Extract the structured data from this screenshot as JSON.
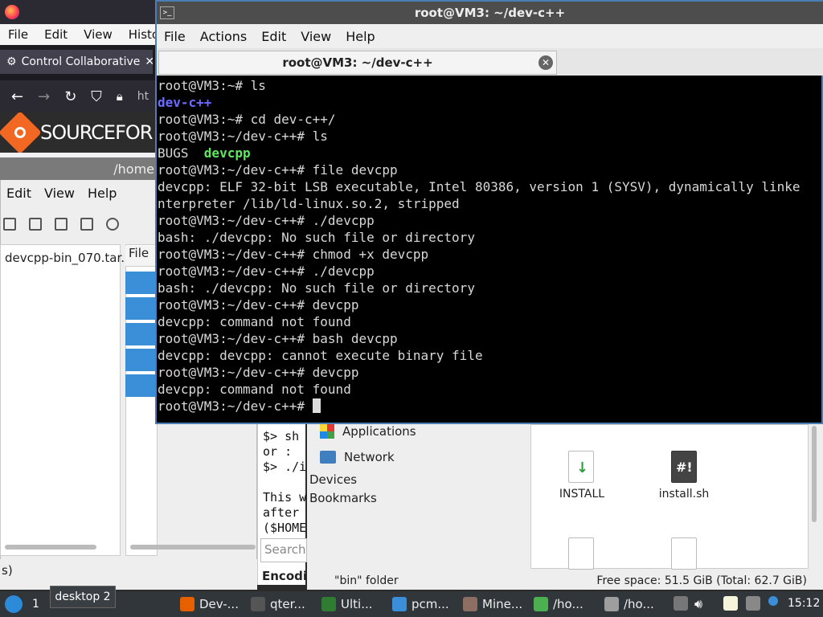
{
  "firefox": {
    "menu": [
      "File",
      "Edit",
      "View",
      "Histo"
    ],
    "tab_label": "Control Collaborative",
    "url_fragment": "ht",
    "site_name": "SOURCEFOR"
  },
  "file_manager_left": {
    "title": "/home",
    "menu": [
      "Edit",
      "View",
      "Help"
    ],
    "tree_item": "devcpp-bin_070.tar.",
    "list_header": "File",
    "status": "s)"
  },
  "middle_text": {
    "lines": [
      "$> sh",
      "or :",
      "$> ./i",
      "",
      "This w",
      "after",
      "($HOME"
    ],
    "search_placeholder": "Search",
    "encoding_label": "Encodin"
  },
  "file_manager_right": {
    "sidebar": {
      "applications": "Applications",
      "network": "Network",
      "devices": "Devices",
      "bookmarks": "Bookmarks"
    },
    "files": [
      {
        "name": "INSTALL"
      },
      {
        "name": "install.sh"
      }
    ],
    "status_left": "\"bin\" folder",
    "status_right": "Free space: 51.5 GiB (Total: 62.7 GiB)"
  },
  "terminal": {
    "window_title": "root@VM3: ~/dev-c++",
    "menu": [
      "File",
      "Actions",
      "Edit",
      "View",
      "Help"
    ],
    "tab_title": "root@VM3: ~/dev-c++",
    "lines": [
      {
        "text": "root@VM3:~# ls"
      },
      {
        "text": "dev-c++",
        "style": "blue"
      },
      {
        "text": "root@VM3:~# cd dev-c++/"
      },
      {
        "text": "root@VM3:~/dev-c++# ls"
      },
      {
        "text": "BUGS  ",
        "extra": "devcpp",
        "extra_style": "green"
      },
      {
        "text": "root@VM3:~/dev-c++# file devcpp"
      },
      {
        "text": "devcpp: ELF 32-bit LSB executable, Intel 80386, version 1 (SYSV), dynamically linke"
      },
      {
        "text": "nterpreter /lib/ld-linux.so.2, stripped"
      },
      {
        "text": "root@VM3:~/dev-c++# ./devcpp"
      },
      {
        "text": "bash: ./devcpp: No such file or directory"
      },
      {
        "text": "root@VM3:~/dev-c++# chmod +x devcpp"
      },
      {
        "text": "root@VM3:~/dev-c++# ./devcpp"
      },
      {
        "text": "bash: ./devcpp: No such file or directory"
      },
      {
        "text": "root@VM3:~/dev-c++# devcpp"
      },
      {
        "text": "devcpp: command not found"
      },
      {
        "text": "root@VM3:~/dev-c++# bash devcpp"
      },
      {
        "text": "devcpp: devcpp: cannot execute binary file"
      },
      {
        "text": "root@VM3:~/dev-c++# devcpp"
      },
      {
        "text": "devcpp: command not found"
      },
      {
        "text": "root@VM3:~/dev-c++# ",
        "cursor": true
      }
    ]
  },
  "taskbar": {
    "workspace": "1",
    "desktop_tooltip": "desktop 2",
    "tasks": [
      {
        "label": "Dev-...",
        "color": "#e66000"
      },
      {
        "label": "qter...",
        "color": "#555555"
      },
      {
        "label": "Ulti...",
        "color": "#2e7d32"
      },
      {
        "label": "pcm...",
        "color": "#3b8fd8"
      },
      {
        "label": "Mine...",
        "color": "#8d6e63"
      },
      {
        "label": "/ho...",
        "color": "#4caf50"
      },
      {
        "label": "/ho...",
        "color": "#9e9e9e"
      }
    ],
    "clock": "15:12"
  }
}
